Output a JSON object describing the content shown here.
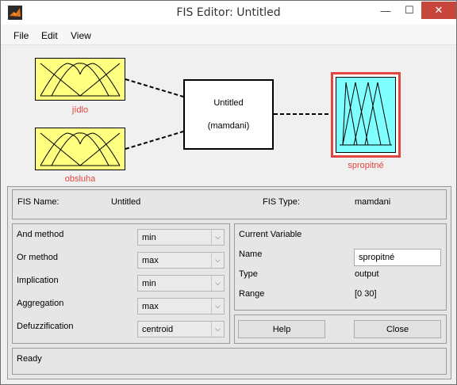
{
  "window": {
    "title": "FIS Editor: Untitled",
    "minimize": "—",
    "maximize": "☐",
    "close": "✕"
  },
  "menu": {
    "file": "File",
    "edit": "Edit",
    "view": "View"
  },
  "diagram": {
    "inputs": [
      {
        "name": "jídlo"
      },
      {
        "name": "obsluha"
      }
    ],
    "system": {
      "name": "Untitled",
      "type": "(mamdani)"
    },
    "output": {
      "name": "spropitné"
    },
    "colors": {
      "input_fill": "#ffff80",
      "output_fill": "#80ffff",
      "selected_border": "#e0453f",
      "label": "#e0453f"
    }
  },
  "fis_info": {
    "name_label": "FIS Name:",
    "name_value": "Untitled",
    "type_label": "FIS Type:",
    "type_value": "mamdani"
  },
  "methods": {
    "and_label": "And method",
    "and_value": "min",
    "or_label": "Or method",
    "or_value": "max",
    "impl_label": "Implication",
    "impl_value": "min",
    "agg_label": "Aggregation",
    "agg_value": "max",
    "defuzz_label": "Defuzzification",
    "defuzz_value": "centroid"
  },
  "current_variable": {
    "title": "Current Variable",
    "name_label": "Name",
    "name_value": "spropitné",
    "type_label": "Type",
    "type_value": "output",
    "range_label": "Range",
    "range_value": "[0 30]"
  },
  "buttons": {
    "help": "Help",
    "close": "Close"
  },
  "status": "Ready"
}
